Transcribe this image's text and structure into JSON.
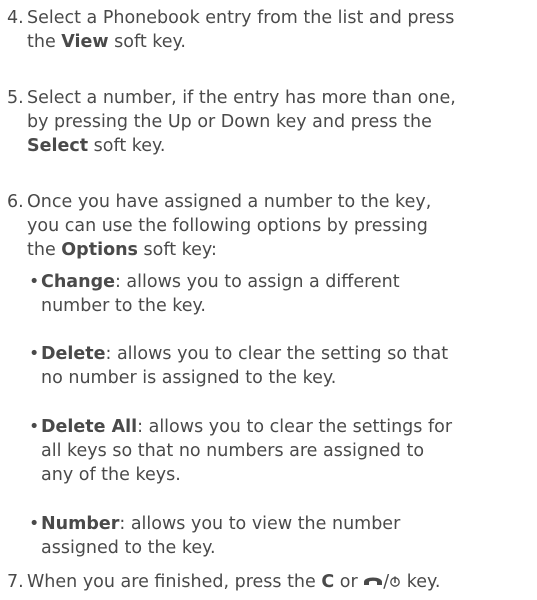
{
  "steps": [
    {
      "number": "4.",
      "l1": "Select a Phonebook entry from the list and press",
      "l2a": "the ",
      "l2b": "View",
      "l2c": " soft key."
    },
    {
      "number": "5.",
      "l1": "Select a number, if the entry has more than one,",
      "l2": "by pressing the Up or Down key and press the",
      "l3a": "Select",
      "l3b": " soft key."
    },
    {
      "number": "6.",
      "l1": "Once you have assigned a number to the key,",
      "l2": "you can use the following options by pressing",
      "l3a": "the ",
      "l3b": "Options",
      "l3c": " soft key:"
    },
    {
      "number": "7.",
      "l1a": "When you are finished, press the ",
      "l1b": "C",
      "l1c": " or ",
      "l1d": "/",
      "l1e": " key.",
      "end_icon": "end-call-icon",
      "power_icon": "power-icon"
    }
  ],
  "options": [
    {
      "bullet": "•",
      "label": "Change",
      "l1": ": allows you to assign a different",
      "l2": "number to the key."
    },
    {
      "bullet": "•",
      "label": "Delete",
      "l1": ": allows you to clear the setting so that",
      "l2": "no number is assigned to the key."
    },
    {
      "bullet": "•",
      "label": "Delete All",
      "l1": ": allows you to clear the settings for",
      "l2": "all keys so that no numbers are assigned to",
      "l3": "any of the keys."
    },
    {
      "bullet": "•",
      "label": "Number",
      "l1": ": allows you to view the number",
      "l2": "assigned to the key."
    }
  ]
}
